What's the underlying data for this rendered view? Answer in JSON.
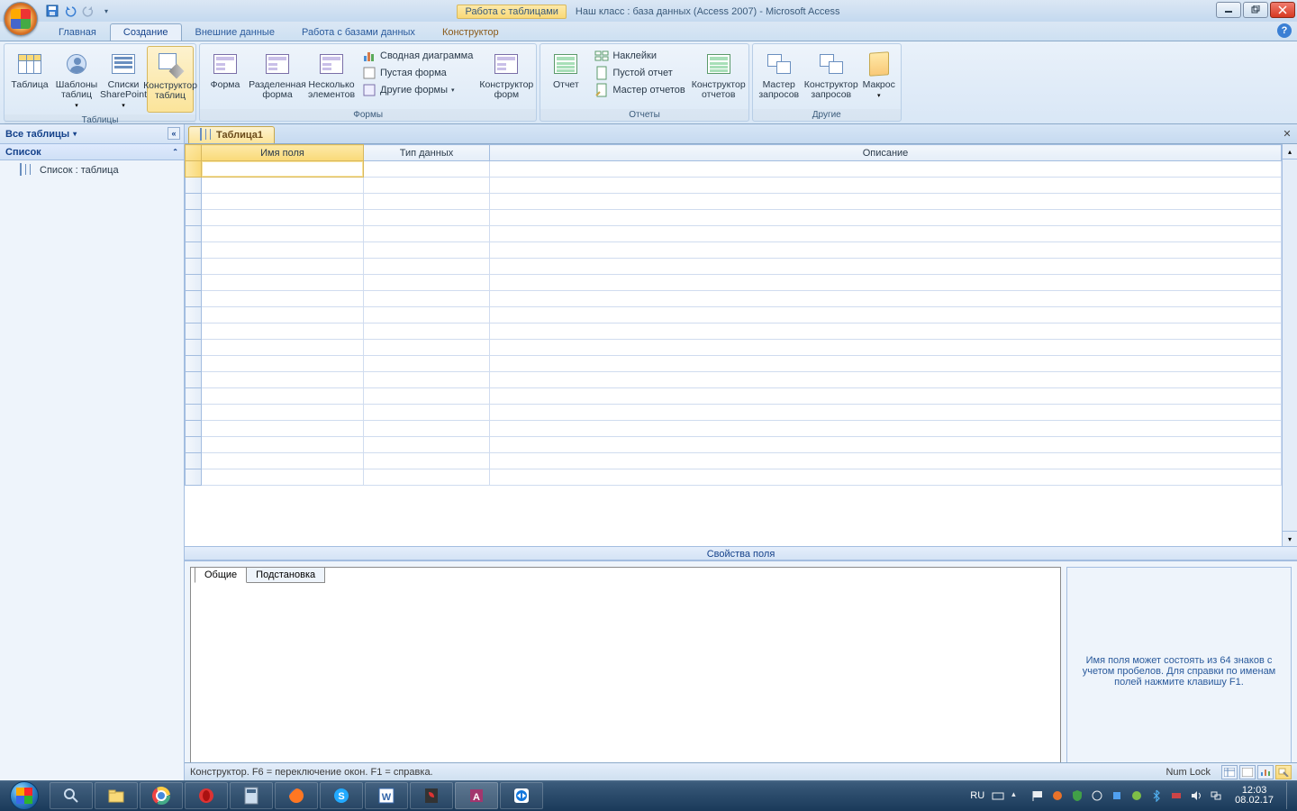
{
  "title": {
    "context_tab": "Работа с таблицами",
    "document": "Наш класс : база данных (Access 2007) - Microsoft Access"
  },
  "tabs": {
    "home": "Главная",
    "create": "Создание",
    "external": "Внешние данные",
    "dbtools": "Работа с базами данных",
    "design": "Конструктор"
  },
  "ribbon": {
    "grp_tables": "Таблицы",
    "btn_table": "Таблица",
    "btn_tmpl": "Шаблоны таблиц",
    "btn_sp": "Списки SharePoint",
    "btn_tdesign": "Конструктор таблиц",
    "grp_forms": "Формы",
    "btn_form": "Форма",
    "btn_split": "Разделенная форма",
    "btn_multi": "Несколько элементов",
    "btn_pivot": "Сводная диаграмма",
    "btn_blank": "Пустая форма",
    "btn_more": "Другие формы",
    "btn_fdesign": "Конструктор форм",
    "grp_reports": "Отчеты",
    "btn_report": "Отчет",
    "btn_labels": "Наклейки",
    "btn_blankr": "Пустой отчет",
    "btn_rwiz": "Мастер отчетов",
    "btn_rdesign": "Конструктор отчетов",
    "grp_other": "Другие",
    "btn_qwiz": "Мастер запросов",
    "btn_qdesign": "Конструктор запросов",
    "btn_macro": "Макрос"
  },
  "nav": {
    "header": "Все таблицы",
    "group": "Список",
    "item1": "Список : таблица"
  },
  "doc": {
    "tab": "Таблица1",
    "col_name": "Имя поля",
    "col_type": "Тип данных",
    "col_desc": "Описание"
  },
  "props": {
    "title": "Свойства поля",
    "tab_general": "Общие",
    "tab_lookup": "Подстановка",
    "hint": "Имя поля может состоять из 64 знаков с учетом пробелов.  Для справки по именам полей нажмите клавишу F1."
  },
  "status": {
    "left": "Конструктор.  F6 = переключение окон.  F1 = справка.",
    "numlock": "Num Lock"
  },
  "tray": {
    "lang": "RU",
    "time": "12:03",
    "date": "08.02.17"
  }
}
